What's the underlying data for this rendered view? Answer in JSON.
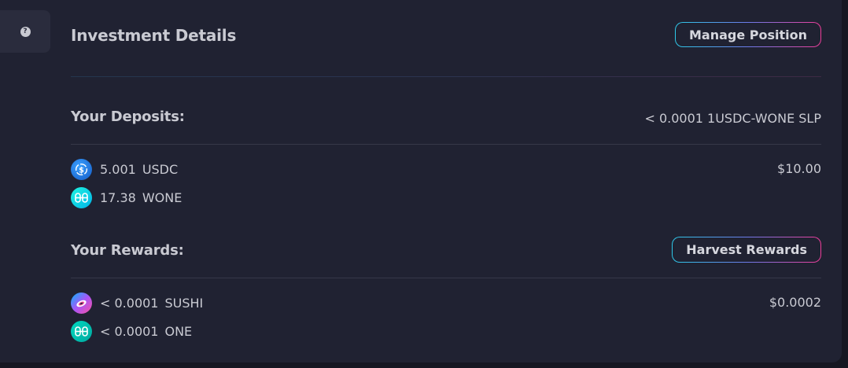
{
  "sidebar": {
    "help_icon_name": "question-circle-icon",
    "help_glyph": "?"
  },
  "header": {
    "title": "Investment Details",
    "manage_button_label": "Manage Position"
  },
  "deposits": {
    "label": "Your Deposits:",
    "lp_amount": "< 0.0001 1USDC-WONE SLP",
    "usd_value": "$10.00",
    "tokens": [
      {
        "amount": "5.001",
        "symbol": "USDC",
        "icon": "usdc-token-icon",
        "color": "#2775ca"
      },
      {
        "amount": "17.38",
        "symbol": "WONE",
        "icon": "harmony-one-token-icon",
        "color": "#00aee9"
      }
    ]
  },
  "rewards": {
    "label": "Your Rewards:",
    "harvest_button_label": "Harvest Rewards",
    "usd_value": "$0.0002",
    "tokens": [
      {
        "amount": "< 0.0001",
        "symbol": "SUSHI",
        "icon": "sushi-token-icon",
        "color": "#fa52a0"
      },
      {
        "amount": "< 0.0001",
        "symbol": "ONE",
        "icon": "harmony-one-token-icon",
        "color": "#00aee9"
      }
    ]
  },
  "colors": {
    "background": "#202232",
    "gradient_start": "#2ec9e8",
    "gradient_end": "#ef3d9a"
  }
}
